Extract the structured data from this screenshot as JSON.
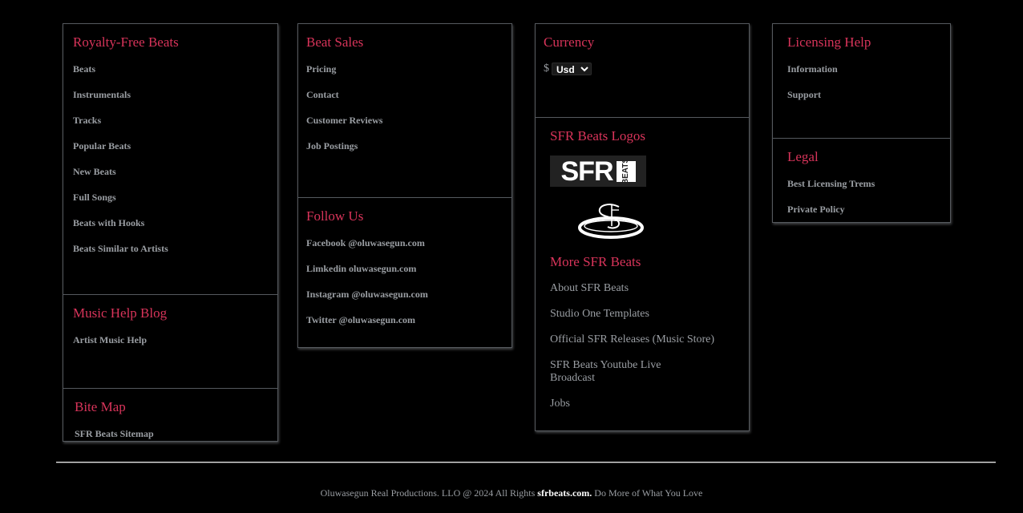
{
  "royalty_free": {
    "title": "Royalty-Free Beats",
    "items": [
      "Beats",
      "Instrumentals",
      "Tracks",
      "Popular Beats",
      "New Beats",
      "Full Songs",
      "Beats with Hooks",
      "Beats Similar to Artists"
    ]
  },
  "music_help_blog": {
    "title": "Music Help Blog",
    "items": [
      "Artist Music Help"
    ]
  },
  "bite_map": {
    "title": "Bite Map",
    "items": [
      "SFR Beats Sitemap"
    ]
  },
  "beat_sales": {
    "title": "Beat Sales",
    "items": [
      "Pricing",
      "Contact",
      "Customer Reviews",
      "Job Postings"
    ]
  },
  "follow_us": {
    "title": "Follow Us",
    "items": [
      "Facebook @oluwasegun.com",
      "Limkedin oluwasegun.com",
      "Instagram @oluwasegun.com",
      "Twitter @oluwasegun.com"
    ]
  },
  "currency": {
    "title": "Currency",
    "symbol": "$",
    "selected": "Usd"
  },
  "logos": {
    "title": "SFR Beats Logos",
    "logo_big_text": "SFR",
    "logo_small_text": "BEATS",
    "logo_alt_icon": "sfr-circle-logo-icon"
  },
  "more_sfr": {
    "title": "More SFR Beats",
    "items": [
      "About SFR Beats",
      "Studio One Templates",
      "Official SFR Releases (Music Store)",
      "SFR Beats Youtube Live Broadcast",
      "Jobs"
    ]
  },
  "licensing_help": {
    "title": "Licensing Help",
    "items": [
      "Information",
      "Support"
    ]
  },
  "legal": {
    "title": "Legal",
    "items": [
      "Best Licensing Trems",
      "Private Policy"
    ]
  },
  "footer": {
    "prefix": "Oluwasegun Real Productions. LLO @ 2024 All Rights ",
    "site": "sfrbeats.com.",
    "suffix": " Do More of What You Love"
  },
  "colors": {
    "background": "#000000",
    "heading": "#d8345a",
    "link": "#9a9ea3",
    "border": "#55595e"
  }
}
